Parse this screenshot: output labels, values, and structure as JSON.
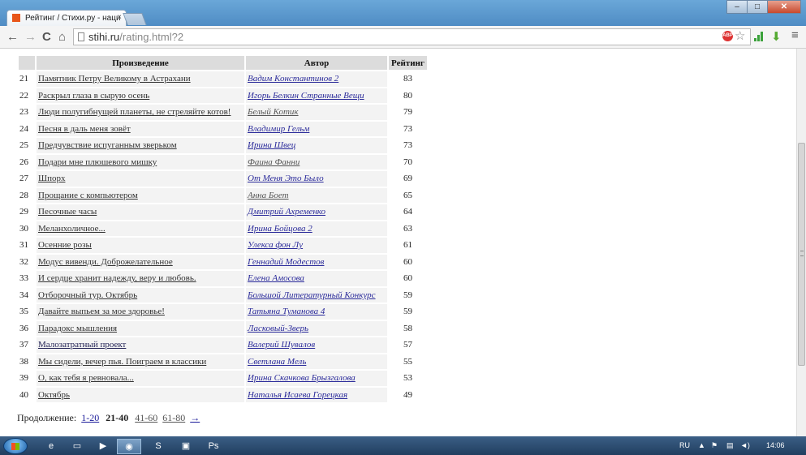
{
  "browser": {
    "tab_title": "Рейтинг / Стихи.ру - наци",
    "tab_close": "×",
    "window_min": "–",
    "window_max": "□",
    "window_close": "✕",
    "url_host": "stihi.ru",
    "url_path": "/rating.html?2",
    "back": "←",
    "forward": "→",
    "reload": "C",
    "home": "⌂",
    "star": "☆",
    "menu": "≡",
    "abp": "ABP"
  },
  "table": {
    "headers": {
      "work": "Произведение",
      "author": "Автор",
      "rating": "Рейтинг"
    },
    "rows": [
      {
        "num": "21",
        "work": "Памятник Петру Великому в Астрахани",
        "author": "Вадим Константинов 2",
        "score": "83"
      },
      {
        "num": "22",
        "work": "Раскрыл глаза в сырую осень",
        "author": "Игорь Белкин Странные Вещи",
        "score": "80"
      },
      {
        "num": "23",
        "work": "Люди полугибнущей планеты, не стреляйте котов!",
        "author": "Белый Котик",
        "score": "79"
      },
      {
        "num": "24",
        "work": "Песня в даль меня зовёт",
        "author": "Владимир Гельм",
        "score": "73"
      },
      {
        "num": "25",
        "work": "Предчувствие испуганным зверьком",
        "author": "Ирина Швец",
        "score": "73"
      },
      {
        "num": "26",
        "work": "Подари мне плюшевого мишку",
        "author": "Фаина Фанни",
        "score": "70"
      },
      {
        "num": "27",
        "work": "Шпорх",
        "author": "От Меня Это Было",
        "score": "69"
      },
      {
        "num": "28",
        "work": "Прощание с компьютером",
        "author": "Анна Боет",
        "score": "65"
      },
      {
        "num": "29",
        "work": "Песочные часы",
        "author": "Дмитрий Ахременко",
        "score": "64"
      },
      {
        "num": "30",
        "work": "Меланхоличное...",
        "author": "Ирина Бойцова 2",
        "score": "63"
      },
      {
        "num": "31",
        "work": "Осенние розы",
        "author": "Улекса фон Лу",
        "score": "61"
      },
      {
        "num": "32",
        "work": "Модус вивенди. Доброжелательное",
        "author": "Геннадий Модестов",
        "score": "60"
      },
      {
        "num": "33",
        "work": "И сердце хранит надежду, веру и любовь.",
        "author": "Елена Амосова",
        "score": "60"
      },
      {
        "num": "34",
        "work": "Отборочный тур. Октябрь",
        "author": "Большой Литературный Конкурс",
        "score": "59"
      },
      {
        "num": "35",
        "work": "Давайте выпьем за мое здоровье!",
        "author": "Татьяна Туманова 4",
        "score": "59"
      },
      {
        "num": "36",
        "work": "Парадокс мышления",
        "author": "Ласковый-Зверь",
        "score": "58"
      },
      {
        "num": "37",
        "work": "Малозатратный проект",
        "author": "Валерий Шувалов",
        "score": "57"
      },
      {
        "num": "38",
        "work": "Мы сидели, вечер пья. Поиграем в классики",
        "author": "Светлана Мель",
        "score": "55"
      },
      {
        "num": "39",
        "work": "О, как тебя я ревновала...",
        "author": "Ирина Скачкова Брызгалова",
        "score": "53"
      },
      {
        "num": "40",
        "work": "Октябрь",
        "author": "Наталья Исаева Горецкая",
        "score": "49"
      }
    ]
  },
  "pager": {
    "label": "Продолжение:",
    "prev": "1-20",
    "current": "21-40",
    "next1": "41-60",
    "next2": "61-80",
    "arrow": "→"
  },
  "taskbar": {
    "lang": "RU",
    "time": "14:06",
    "tray_arrow": "▲"
  }
}
